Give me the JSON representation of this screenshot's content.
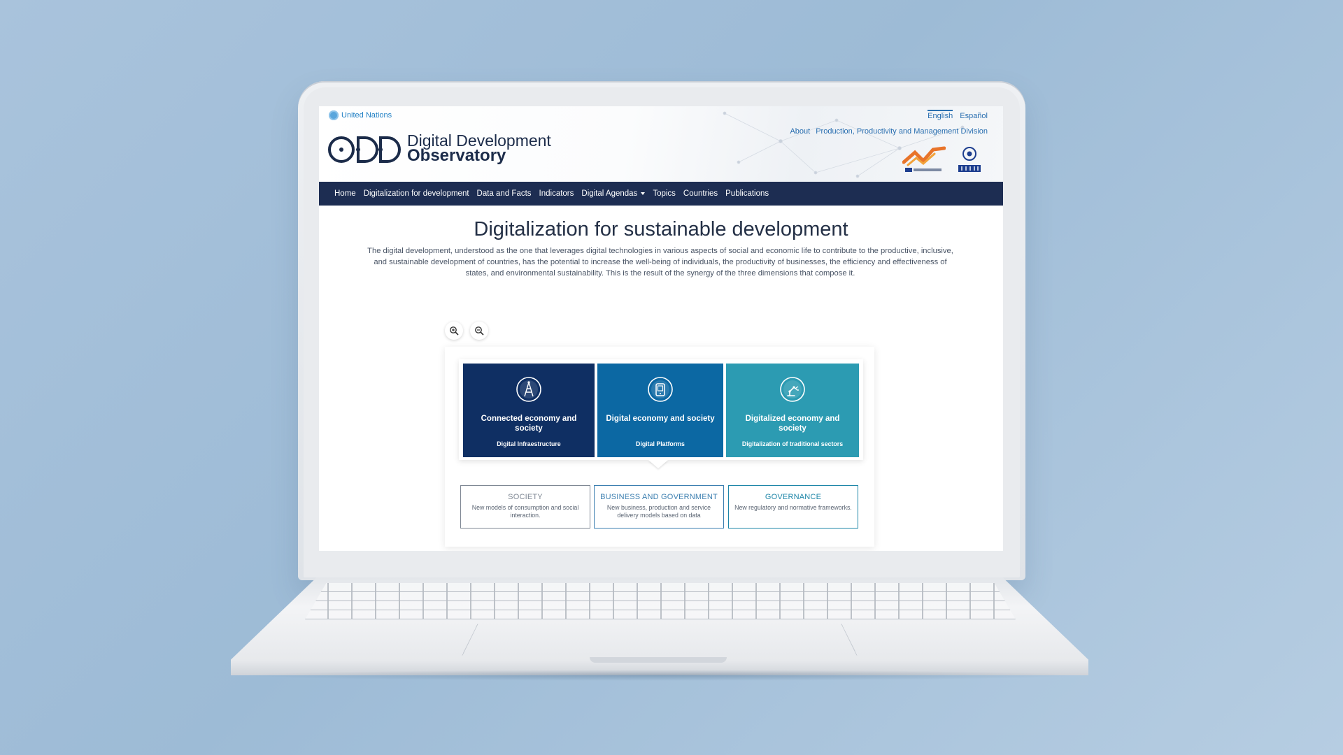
{
  "site": {
    "un_label": "United Nations",
    "languages": [
      "English",
      "Español"
    ],
    "active_language": "English",
    "links": [
      "About",
      "Production, Productivity and Management Division"
    ],
    "logo_line1": "Digital Development",
    "logo_line2": "Observatory"
  },
  "nav": [
    {
      "label": "Home"
    },
    {
      "label": "Digitalization for development"
    },
    {
      "label": "Data and Facts"
    },
    {
      "label": "Indicators"
    },
    {
      "label": "Digital Agendas",
      "dropdown": true
    },
    {
      "label": "Topics"
    },
    {
      "label": "Countries"
    },
    {
      "label": "Publications"
    }
  ],
  "page": {
    "title": "Digitalization for sustainable development",
    "intro": "The digital development, understood as the one that leverages digital technologies in various aspects of social and economic life to contribute to the productive, inclusive, and sustainable development of countries, has the potential to increase the well-being of individuals, the productivity of businesses, the efficiency and effectiveness of states, and environmental sustainability. This is the result of the synergy of the three dimensions that compose it."
  },
  "zoom": {
    "in_icon": "zoom-in-icon",
    "out_icon": "zoom-out-icon"
  },
  "cards": [
    {
      "title": "Connected economy and society",
      "subtitle": "Digital Infraestructure",
      "color": "#0f2f63",
      "icon": "antenna-tower-icon"
    },
    {
      "title": "Digital economy and society",
      "subtitle": "Digital Platforms",
      "color": "#0c68a3",
      "icon": "mobile-app-icon"
    },
    {
      "title": "Digitalized economy and society",
      "subtitle": "Digitalization of traditional sectors",
      "color": "#2c9bb2",
      "icon": "robot-arm-icon"
    }
  ],
  "dimensions": [
    {
      "title": "SOCIETY",
      "desc": "New models of consumption and social interaction.",
      "color": "#7f8894"
    },
    {
      "title": "BUSINESS AND GOVERNMENT",
      "desc": "New business, production and service delivery models based on data",
      "color": "#3c7fb0"
    },
    {
      "title": "GOVERNANCE",
      "desc": "New regulatory and normative frameworks.",
      "color": "#1e86a8"
    }
  ],
  "colors": {
    "nav_bg": "#1d2d52",
    "link": "#2a6fb0",
    "background": "#a9c3dc"
  }
}
